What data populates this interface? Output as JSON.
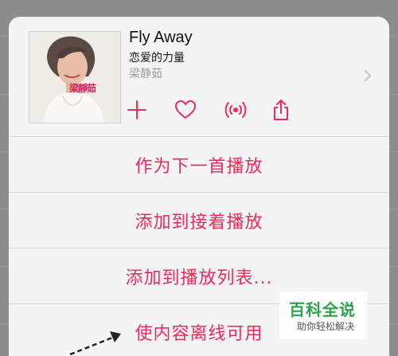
{
  "song": {
    "title": "Fly Away",
    "album": "恋爱的力量",
    "artist": "梁静茹",
    "album_art_text": "梁靜茹"
  },
  "actions": [
    {
      "name": "add",
      "icon": "plus-icon"
    },
    {
      "name": "love",
      "icon": "heart-icon"
    },
    {
      "name": "radio",
      "icon": "broadcast-icon"
    },
    {
      "name": "share",
      "icon": "share-icon"
    }
  ],
  "menu": {
    "play_next": "作为下一首播放",
    "play_later": "添加到接着播放",
    "add_to_playlist": "添加到播放列表...",
    "make_offline": "使内容离线可用"
  },
  "watermark": {
    "title": "百科全说",
    "subtitle": "助你轻松解决"
  },
  "colors": {
    "accent": "#ee2b5a",
    "sheet_bg": "#f4f4f4",
    "watermark_green": "#2ea24a"
  }
}
